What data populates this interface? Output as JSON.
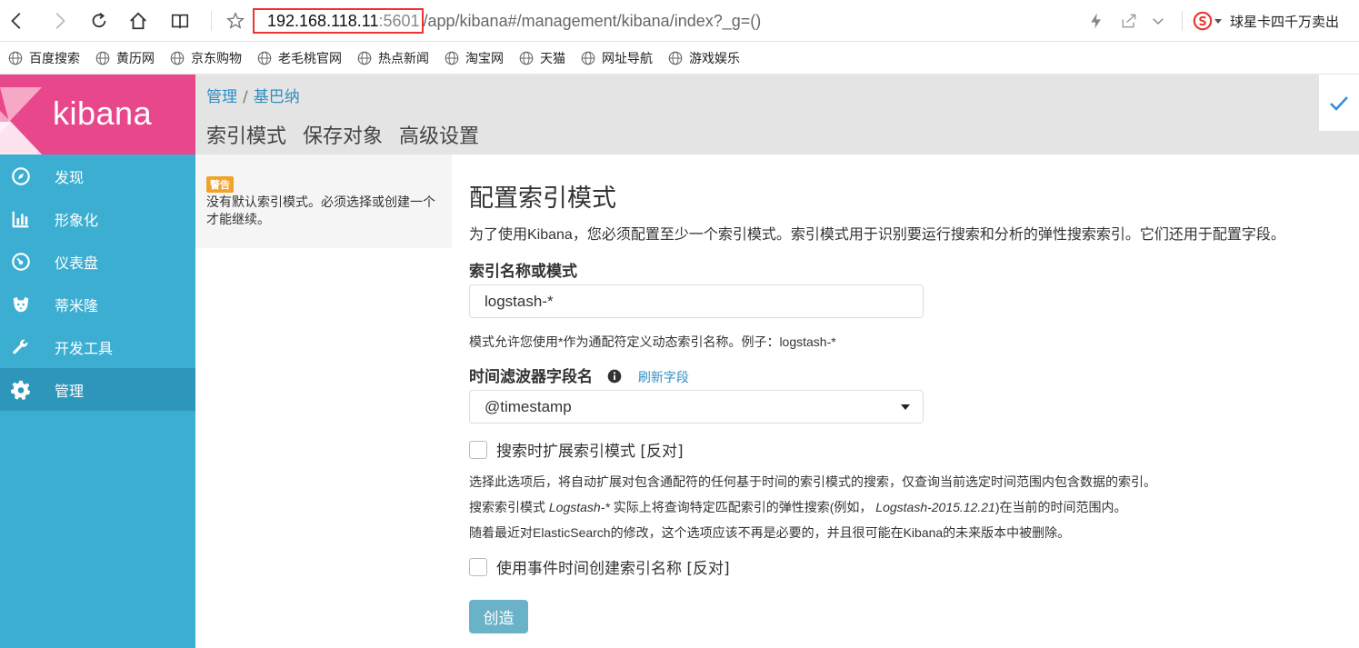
{
  "browser": {
    "url_host": "192.168.118.11",
    "url_port": ":5601",
    "url_path": "/app/kibana#/management/kibana/index?_g=()",
    "sogou_label": "球星卡四千万卖出"
  },
  "bookmarks": [
    "百度搜索",
    "黄历网",
    "京东购物",
    "老毛桃官网",
    "热点新闻",
    "淘宝网",
    "天猫",
    "网址导航",
    "游戏娱乐"
  ],
  "sidebar": {
    "logo": "kibana",
    "items": [
      {
        "label": "发现",
        "icon": "compass-icon"
      },
      {
        "label": "形象化",
        "icon": "bar-chart-icon"
      },
      {
        "label": "仪表盘",
        "icon": "dashboard-icon"
      },
      {
        "label": "蒂米隆",
        "icon": "timelion-icon"
      },
      {
        "label": "开发工具",
        "icon": "wrench-icon"
      },
      {
        "label": "管理",
        "icon": "gear-icon"
      }
    ],
    "active_index": 5
  },
  "header": {
    "breadcrumb": [
      "管理",
      "基巴纳"
    ],
    "breadcrumb_sep": "/",
    "tabs": [
      "索引模式",
      "保存对象",
      "高级设置"
    ]
  },
  "warning": {
    "badge": "警告",
    "text": "没有默认索引模式。必须选择或创建一个才能继续。"
  },
  "form": {
    "title": "配置索引模式",
    "description": "为了使用Kibana，您必须配置至少一个索引模式。索引模式用于识别要运行搜索和分析的弹性搜索索引。它们还用于配置字段。",
    "index_label": "索引名称或模式",
    "index_value": "logstash-*",
    "index_help": "模式允许您使用*作为通配符定义动态索引名称。例子：logstash-*",
    "time_label": "时间滤波器字段名",
    "refresh_link": "刷新字段",
    "time_value": "@timestamp",
    "expand_label": "搜索时扩展索引模式 [反对]",
    "expand_help_1": "选择此选项后，将自动扩展对包含通配符的任何基于时间的索引模式的搜索，仅查询当前选定时间范围内包含数据的索引。",
    "expand_help_2_a": "搜索索引模式 ",
    "expand_help_2_b": "Logstash-*",
    "expand_help_2_c": " 实际上将查询特定匹配索引的弹性搜索(例如，",
    "expand_help_2_d": "Logstash-2015.12.21",
    "expand_help_2_e": ")在当前的时间范围内。",
    "expand_help_3": "随着最近对ElasticSearch的修改，这个选项应该不再是必要的，并且很可能在Kibana的未来版本中被删除。",
    "event_label": "使用事件时间创建索引名称 [反对]",
    "create_button": "创造"
  }
}
